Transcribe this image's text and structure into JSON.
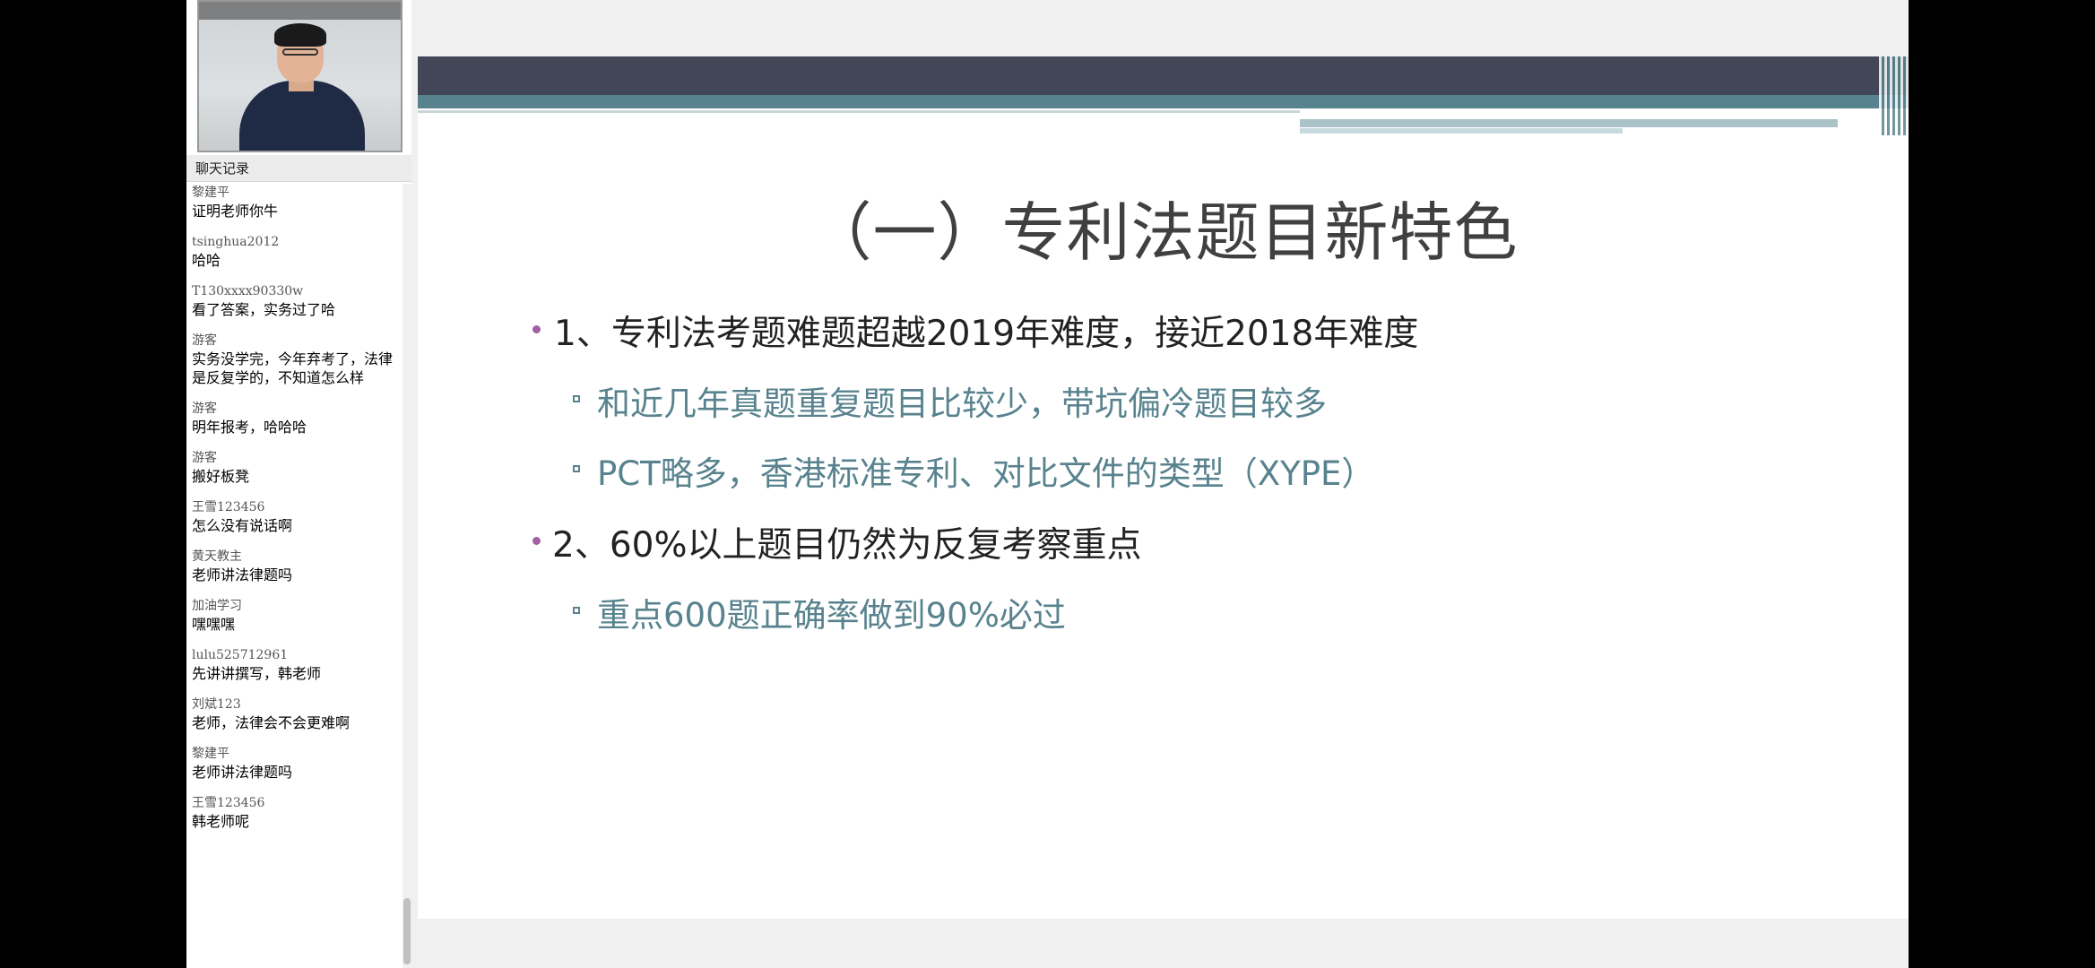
{
  "chat": {
    "header": "聊天记录",
    "messages": [
      {
        "user": "黎建平",
        "text": "证明老师你牛"
      },
      {
        "user": "tsinghua2012",
        "text": "哈哈"
      },
      {
        "user": "T130xxxx90330w",
        "text": "看了答案，实务过了哈"
      },
      {
        "user": "游客",
        "text": "实务没学完，今年弃考了，法律是反复学的，不知道怎么样"
      },
      {
        "user": "游客",
        "text": "明年报考，哈哈哈"
      },
      {
        "user": "游客",
        "text": "搬好板凳"
      },
      {
        "user": "王雪123456",
        "text": "怎么没有说话啊"
      },
      {
        "user": "黄天教主",
        "text": "老师讲法律题吗"
      },
      {
        "user": "加油学习",
        "text": "嘿嘿嘿"
      },
      {
        "user": "lulu525712961",
        "text": "先讲讲撰写，韩老师"
      },
      {
        "user": "刘斌123",
        "text": "老师，法律会不会更难啊"
      },
      {
        "user": "黎建平",
        "text": "老师讲法律题吗"
      },
      {
        "user": "王雪123456",
        "text": "韩老师呢"
      }
    ]
  },
  "slide": {
    "title": "（一）专利法题目新特色",
    "bullet1": "1、专利法考题难题超越2019年难度，接近2018年难度",
    "sub1a": "和近几年真题重复题目比较少，带坑偏冷题目较多",
    "sub1b": "PCT略多，香港标准专利、对比文件的类型（XYPE）",
    "bullet2": "2、60%以上题目仍然为反复考察重点",
    "sub2a": "重点600题正确率做到90%必过"
  },
  "colors": {
    "bar_dark": "#414757",
    "accent_teal": "#58838e",
    "bullet_purple": "#a25fa5"
  }
}
